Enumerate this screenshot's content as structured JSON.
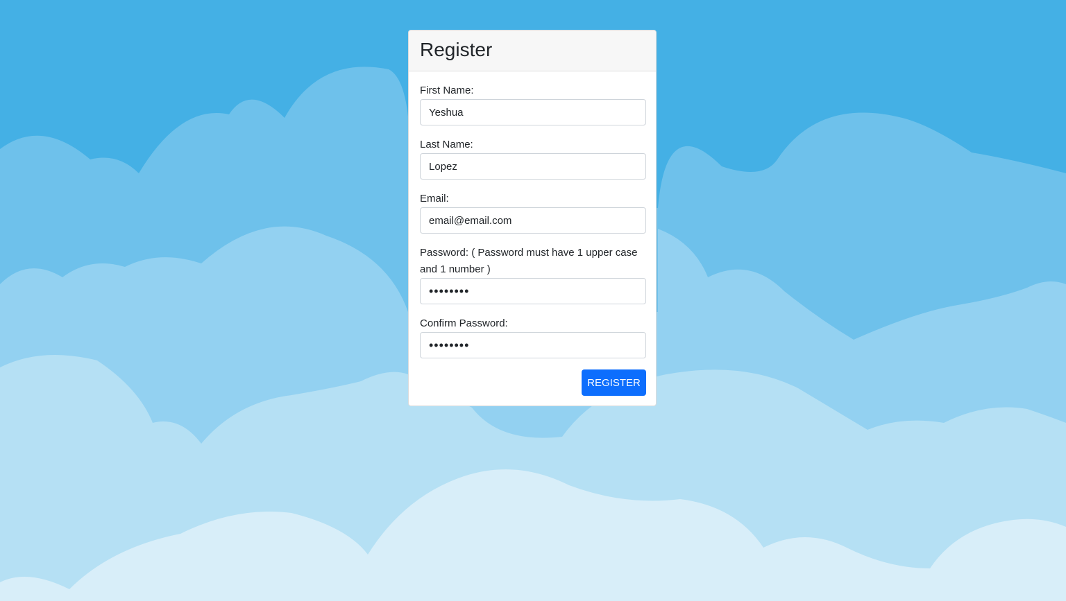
{
  "colors": {
    "sky": "#44b0e5",
    "cloud_layer_1": "#6ec1eb",
    "cloud_layer_2": "#93d1f1",
    "cloud_layer_3": "#b5e0f4",
    "cloud_layer_4": "#d8eef9",
    "button": "#0d6efd"
  },
  "form": {
    "title": "Register",
    "first_name": {
      "label": "First Name:",
      "value": "Yeshua"
    },
    "last_name": {
      "label": "Last Name:",
      "value": "Lopez"
    },
    "email": {
      "label": "Email:",
      "value": "email@email.com"
    },
    "password": {
      "label": "Password: ( Password must have 1 upper case and 1 number )",
      "value": "••••••••"
    },
    "confirm_password": {
      "label": "Confirm Password:",
      "value": "••••••••"
    },
    "submit_label": "REGISTER"
  }
}
